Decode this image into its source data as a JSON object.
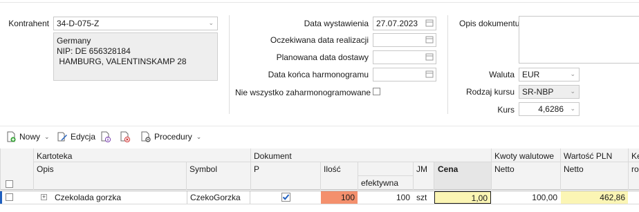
{
  "header": {
    "kontrahent_label": "Kontrahent",
    "kontrahent_value": "34-D-075-Z",
    "address_line1": "Germany",
    "address_line2": "NIP: DE 656328184",
    "address_line3": " HAMBURG, VALENTINSKAMP 28"
  },
  "dates": {
    "data_wystawienia_label": "Data wystawienia",
    "data_wystawienia_value": "27.07.2023",
    "oczekiwana_label": "Oczekiwana data realizacji",
    "oczekiwana_value": "",
    "planowana_label": "Planowana data dostawy",
    "planowana_value": "",
    "koniec_label": "Data końca harmonogramu",
    "koniec_value": "",
    "niezaharm_label": "Nie wszystko zaharmonogramowane"
  },
  "document": {
    "opis_label": "Opis dokumentu",
    "opis_value": "",
    "waluta_label": "Waluta",
    "waluta_value": "EUR",
    "rodzaj_kursu_label": "Rodzaj kursu",
    "rodzaj_kursu_value": "SR-NBP",
    "kurs_label": "Kurs",
    "kurs_value": "4,6286"
  },
  "toolbar": {
    "nowy": "Nowy",
    "edycja": "Edycja",
    "procedury": "Procedury"
  },
  "grid": {
    "group_kartoteka": "Kartoteka",
    "group_dokument": "Dokument",
    "group_kwoty": "Kwoty walutowe",
    "group_wartosc": "Wartość PLN",
    "group_ke": "Ke",
    "col_opis": "Opis",
    "col_symbol": "Symbol",
    "col_p": "P",
    "col_ilosc": "Ilość",
    "col_efektywna": "efektywna",
    "col_jm": "JM",
    "col_cena": "Cena",
    "col_netto1": "Netto",
    "col_netto2": "Netto",
    "col_ro": "ro",
    "rows": [
      {
        "opis": "Czekolada gorzka",
        "symbol": "CzekoGorzka",
        "ilosc": "100",
        "efektywna": "100",
        "jm": "szt",
        "cena": "1,00",
        "netto_walutowe": "100,00",
        "netto_pln": "462,86"
      }
    ]
  },
  "colors": {
    "ilosc_bg": "#f4906d",
    "cena_bg": "#fbf5b4",
    "netto_pln_bg": "#fbf5b4",
    "accent": "#1f5fbf"
  }
}
